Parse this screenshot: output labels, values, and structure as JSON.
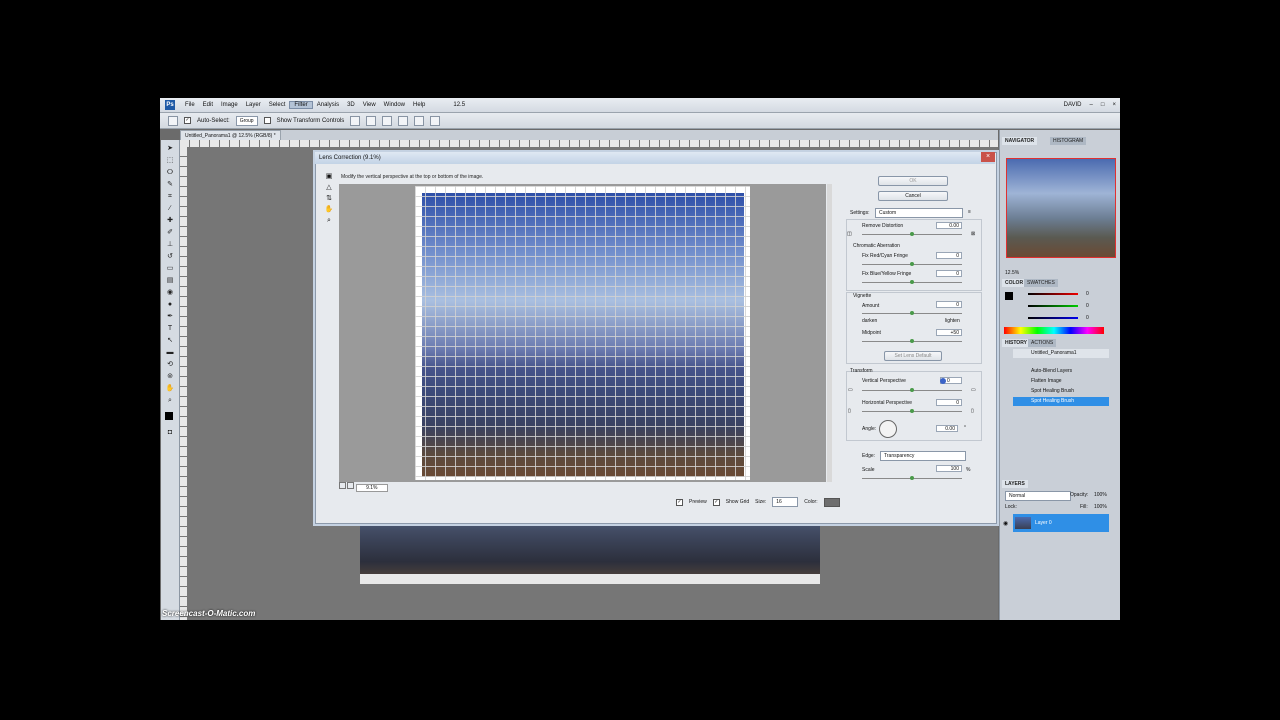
{
  "colors": {
    "accent": "#2f8fe6",
    "menubar": "#dde3ea",
    "desktop": "#000000"
  },
  "menu": {
    "logo": "Ps",
    "items": [
      "File",
      "Edit",
      "Image",
      "Layer",
      "Select",
      "Filter",
      "Analysis",
      "3D",
      "View",
      "Window",
      "Help"
    ],
    "zoom": "12.5",
    "workspace": "DAVID"
  },
  "options": {
    "auto_select": "Auto-Select:",
    "group": "Group",
    "transform": "Show Transform Controls"
  },
  "document": {
    "tab": "Untitled_Panorama1 @ 12.5% (RGB/8) *"
  },
  "dialog": {
    "title": "Lens Correction (9.1%)",
    "hint": "Modify the vertical perspective at the top or bottom of the image.",
    "ok": "OK",
    "cancel": "Cancel",
    "settings_label": "Settings:",
    "settings_value": "Custom",
    "remove_distortion": "Remove Distortion",
    "remove_distortion_val": "0.00",
    "chromatic": "Chromatic Aberration",
    "fix_rc": "Fix Red/Cyan Fringe",
    "fix_rc_val": "0",
    "fix_by": "Fix Blue/Yellow Fringe",
    "fix_by_val": "0",
    "vignette": "Vignette",
    "amount": "Amount",
    "amount_val": "0",
    "darken": "darken",
    "lighten": "lighten",
    "midpoint": "Midpoint",
    "midpoint_val": "+50",
    "set_lens_default": "Set Lens Default",
    "transform": "Transform",
    "vertical": "Vertical Perspective",
    "vertical_val": "0",
    "horizontal": "Horizontal Perspective",
    "horizontal_val": "0",
    "angle": "Angle:",
    "angle_val": "0.00",
    "degree": "°",
    "edge_label": "Edge:",
    "edge_value": "Transparency",
    "scale": "Scale",
    "scale_val": "100",
    "percent": "%",
    "zoom": "9.1%",
    "preview": "Preview",
    "show_grid": "Show Grid",
    "size": "Size:",
    "size_val": "16",
    "color": "Color:"
  },
  "panels": {
    "navigator": "NAVIGATOR",
    "histogram": "HISTOGRAM",
    "nav_zoom": "12.5%",
    "color": "COLOR",
    "swatches": "SWATCHES",
    "history": "HISTORY",
    "actions": "ACTIONS",
    "history_items": [
      "Untitled_Panorama1",
      "Auto-Blend Layers",
      "Flatten Image",
      "Spot Healing Brush",
      "Spot Healing Brush"
    ],
    "layers": "LAYERS",
    "blend": "Normal",
    "opacity": "Opacity:",
    "opacity_val": "100%",
    "lock": "Lock:",
    "fill": "Fill:",
    "fill_val": "100%",
    "layer_name": "Layer 0",
    "color_vals": [
      "0",
      "0",
      "0"
    ]
  },
  "watermark": "Screencast-O-Matic.com"
}
